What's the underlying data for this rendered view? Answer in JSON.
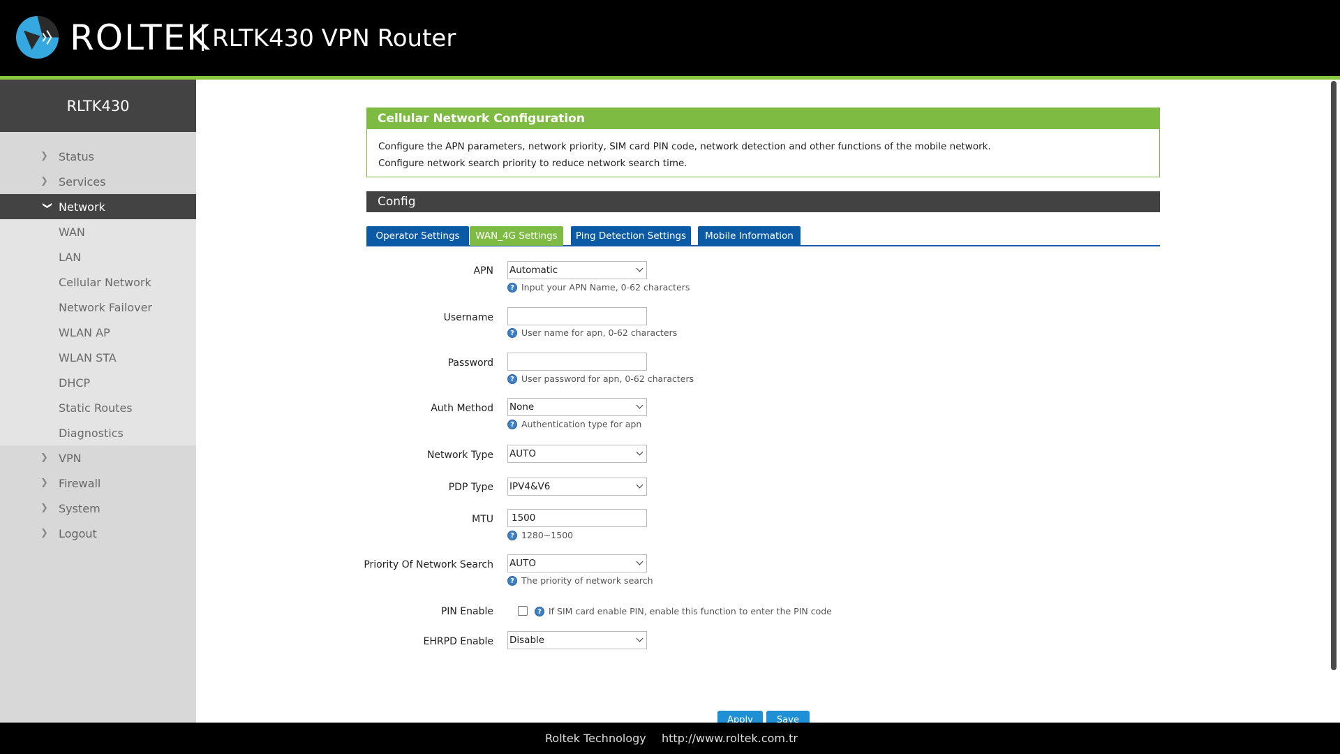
{
  "header": {
    "brand": "ROLTEK",
    "product": "RLTK430 VPN Router",
    "logo_icon": "roltek-logo-icon"
  },
  "sidebar": {
    "title": "RLTK430",
    "items": [
      {
        "label": "Status"
      },
      {
        "label": "Services"
      },
      {
        "label": "Network"
      },
      {
        "label": "WAN"
      },
      {
        "label": "LAN"
      },
      {
        "label": "Cellular Network"
      },
      {
        "label": "Network Failover"
      },
      {
        "label": "WLAN AP"
      },
      {
        "label": "WLAN STA"
      },
      {
        "label": "DHCP"
      },
      {
        "label": "Static Routes"
      },
      {
        "label": "Diagnostics"
      },
      {
        "label": "VPN"
      },
      {
        "label": "Firewall"
      },
      {
        "label": "System"
      },
      {
        "label": "Logout"
      }
    ]
  },
  "info_panel": {
    "title": "Cellular Network Configuration",
    "line1": "Configure the APN parameters, network priority, SIM card PIN code, network detection and other functions of the mobile network.",
    "line2": "Configure network search priority to reduce network search time."
  },
  "config": {
    "title": "Config"
  },
  "tabs": [
    {
      "label": "Operator Settings"
    },
    {
      "label": "WAN_4G Settings"
    },
    {
      "label": "Ping Detection Settings"
    },
    {
      "label": "Mobile Information"
    }
  ],
  "form": {
    "apn": {
      "label": "APN",
      "value": "Automatic",
      "hint": "Input your APN Name, 0-62 characters"
    },
    "username": {
      "label": "Username",
      "value": "",
      "hint": "User name for apn, 0-62 characters"
    },
    "password": {
      "label": "Password",
      "value": "",
      "hint": "User password for apn, 0-62 characters"
    },
    "auth": {
      "label": "Auth Method",
      "value": "None",
      "hint": "Authentication type for apn"
    },
    "network_type": {
      "label": "Network Type",
      "value": "AUTO"
    },
    "pdp_type": {
      "label": "PDP Type",
      "value": "IPV4&V6"
    },
    "mtu": {
      "label": "MTU",
      "value": "1500",
      "hint": "1280~1500"
    },
    "priority": {
      "label": "Priority Of Network Search",
      "value": "AUTO",
      "hint": "The priority of network search"
    },
    "pin": {
      "label": "PIN Enable",
      "checked": false,
      "hint": "If SIM card enable PIN, enable this function to enter the PIN code"
    },
    "ehrpd": {
      "label": "EHRPD Enable",
      "value": "Disable"
    }
  },
  "buttons": {
    "apply": "Apply",
    "save": "Save"
  },
  "footer": {
    "company": "Roltek Technology",
    "url": "http://www.roltek.com.tr"
  },
  "colors": {
    "accent_green": "#7dbb42",
    "tab_blue": "#0a5aa6",
    "button_blue": "#1f8fd6"
  }
}
